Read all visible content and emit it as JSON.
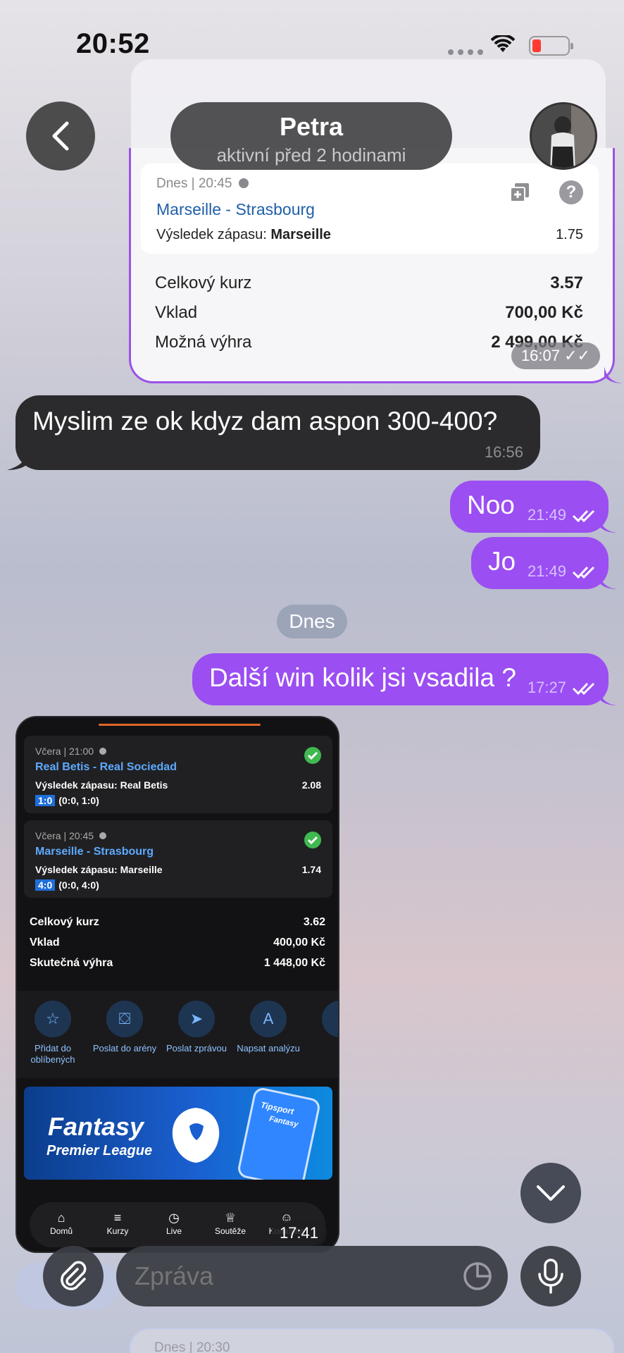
{
  "status_bar": {
    "time": "20:52"
  },
  "header": {
    "back_icon": "chevron-left-icon",
    "contact_name": "Petra",
    "contact_status": "aktivní před 2 hodinami"
  },
  "bet_card": {
    "date": "Dnes | 20:45",
    "match": "Marseille - Strasbourg",
    "result_label": "Výsledek zápasu:",
    "result_value": "Marseille",
    "odd": "1.75",
    "total_odds_label": "Celkový kurz",
    "total_odds_value": "3.57",
    "stake_label": "Vklad",
    "stake_value": "700,00 Kč",
    "possible_win_label": "Možná výhra",
    "possible_win_value": "2 499,00 Kč",
    "time": "16:07"
  },
  "messages": [
    {
      "text": "Myslim ze ok kdyz dam aspon 300-400?",
      "time": "16:56"
    },
    {
      "text": "Noo",
      "time": "21:49"
    },
    {
      "text": "Jo",
      "time": "21:49"
    },
    {
      "text": "Další win kolik jsi vsadila ?",
      "time": "17:27"
    }
  ],
  "date_separator": "Dnes",
  "screenshot": {
    "bets": [
      {
        "date": "Včera | 21:00",
        "match": "Real Betis - Real Sociedad",
        "result": "Výsledek zápasu: Real Betis",
        "odd": "2.08",
        "score": "1:0",
        "half": "(0:0, 1:0)"
      },
      {
        "date": "Včera | 20:45",
        "match": "Marseille - Strasbourg",
        "result": "Výsledek zápasu: Marseille",
        "odd": "1.74",
        "score": "4:0",
        "half": "(0:0, 4:0)"
      }
    ],
    "total_odds_label": "Celkový kurz",
    "total_odds_value": "3.62",
    "stake_label": "Vklad",
    "stake_value": "400,00 Kč",
    "actual_win_label": "Skutečná výhra",
    "actual_win_value": "1 448,00 Kč",
    "actions": [
      {
        "icon": "star-icon",
        "label": "Přidat do oblíbených"
      },
      {
        "icon": "arena-icon",
        "label": "Poslat do arény"
      },
      {
        "icon": "send-icon",
        "label": "Poslat zprávou"
      },
      {
        "icon": "analysis-icon",
        "label": "Napsat analýzu"
      }
    ],
    "banner_title": "Fantasy",
    "banner_subtitle": "Premier League",
    "banner_brand": "Tipsport",
    "banner_phone_label": "Fantasy",
    "tabs": [
      "Domů",
      "Kurzy",
      "Live",
      "Soutěže",
      "Komunita"
    ],
    "time": "17:41"
  },
  "composer": {
    "placeholder": "Zpráva",
    "attach_icon": "paperclip-icon",
    "sticker_icon": "sticker-icon",
    "mic_icon": "microphone-icon"
  },
  "bottom_ghost": {
    "date": "Dnes | 20:30"
  },
  "colors": {
    "outgoing_bubble": "#9b4ef2",
    "incoming_bubble": "#2b2b2d",
    "link_blue": "#1f5fa8"
  }
}
